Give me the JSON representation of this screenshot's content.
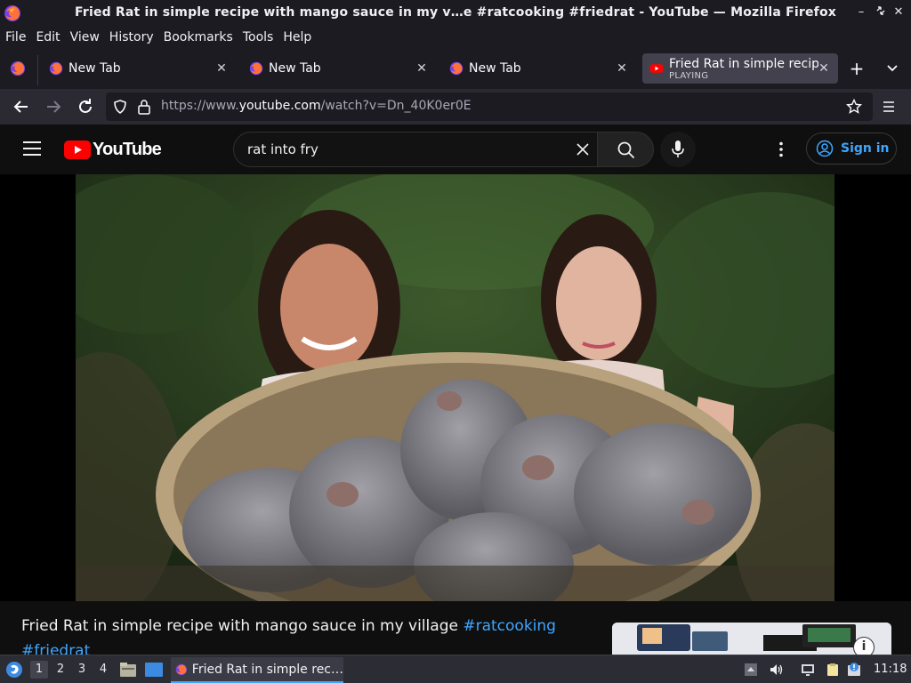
{
  "window": {
    "title": "Fried Rat in simple recipe with mango sauce in my v…e #ratcooking #friedrat - YouTube — Mozilla Firefox"
  },
  "menu": {
    "items": [
      "File",
      "Edit",
      "View",
      "History",
      "Bookmarks",
      "Tools",
      "Help"
    ]
  },
  "tabs": [
    {
      "label": "New Tab"
    },
    {
      "label": "New Tab"
    },
    {
      "label": "New Tab"
    },
    {
      "label": "Fried Rat in simple recipe",
      "status": "PLAYING"
    }
  ],
  "navbar": {
    "url_prefix": "https://www.",
    "url_domain": "youtube.com",
    "url_path": "/watch?v=Dn_40K0er0E"
  },
  "youtube": {
    "logo_text": "YouTube",
    "search_value": "rat into fry",
    "signin_label": "Sign in"
  },
  "video": {
    "title_main": "Fried Rat in simple recipe with mango sauce in my village ",
    "hashtag1": "#ratcooking",
    "hashtag2": "#friedrat"
  },
  "taskbar": {
    "workspaces": [
      "1",
      "2",
      "3",
      "4"
    ],
    "task_label": "Fried Rat in simple rec…",
    "clock": "11:18"
  },
  "colors": {
    "youtube_red": "#ff0000",
    "link_blue": "#3ea6ff",
    "firefox_dark": "#1c1b22"
  }
}
